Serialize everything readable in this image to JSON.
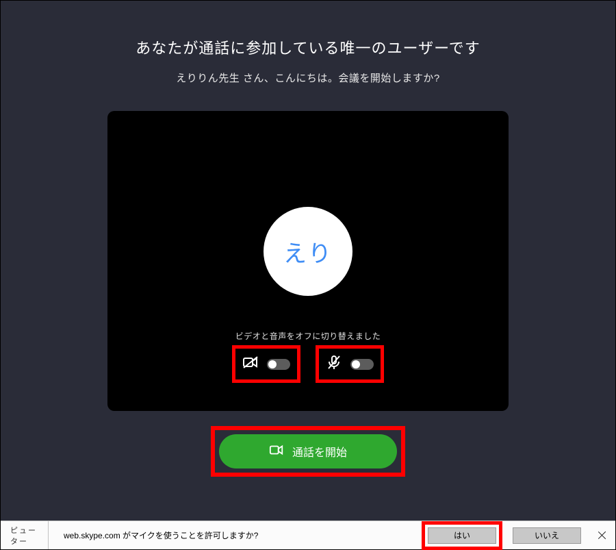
{
  "main": {
    "heading": "あなたが通話に参加している唯一のユーザーです",
    "subheading": "えりりん先生 さん、こんにちは。会議を開始しますか?",
    "avatar_text": "えり",
    "status_text": "ビデオと音声をオフに切り替えました",
    "start_call_label": "通話を開始"
  },
  "toggles": {
    "video_on": false,
    "audio_on": false
  },
  "permission": {
    "left_tab": "ピューター",
    "prompt": "web.skype.com がマイクを使うことを許可しますか?",
    "yes": "はい",
    "no": "いいえ"
  },
  "colors": {
    "background": "#2a2c38",
    "accent_green": "#2fa82f",
    "avatar_text": "#3f8df5",
    "highlight": "#ff0000"
  }
}
